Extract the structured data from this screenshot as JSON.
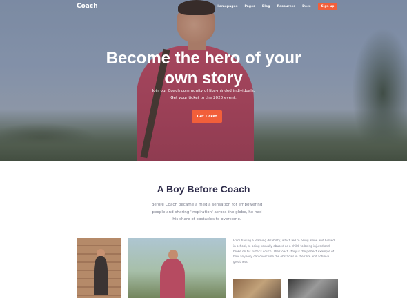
{
  "nav": {
    "logo": "Coach",
    "items": [
      "Homepages",
      "Pages",
      "Blog",
      "Resources",
      "Docs"
    ],
    "signup_label": "Sign up"
  },
  "hero": {
    "title_line1": "Become the hero of your",
    "title_line2": "own story",
    "subtitle_line1": "Join our Coach community of like-minded individuals.",
    "subtitle_line2": "Get your ticket to the 2020 event.",
    "cta_label": "Get Ticket"
  },
  "story": {
    "title": "A Boy Before Coach",
    "text_line1": "Before Coach became a media sensation for empowering",
    "text_line2": "people and sharing 'inspiration' across the globe, he had",
    "text_line3": "his share of obstacles to overcome.",
    "side_text": "From having a learning disability, which led to being alone and bullied in school, to being sexually abused as a child, to being injured and broke on his sister's couch. The Coach story is the perfect example of how anybody can overcome the obstacles in their life and achieve greatness."
  },
  "colors": {
    "accent": "#f25f3a",
    "heading": "#2f2d4b",
    "body_text": "#7a7d8c"
  }
}
